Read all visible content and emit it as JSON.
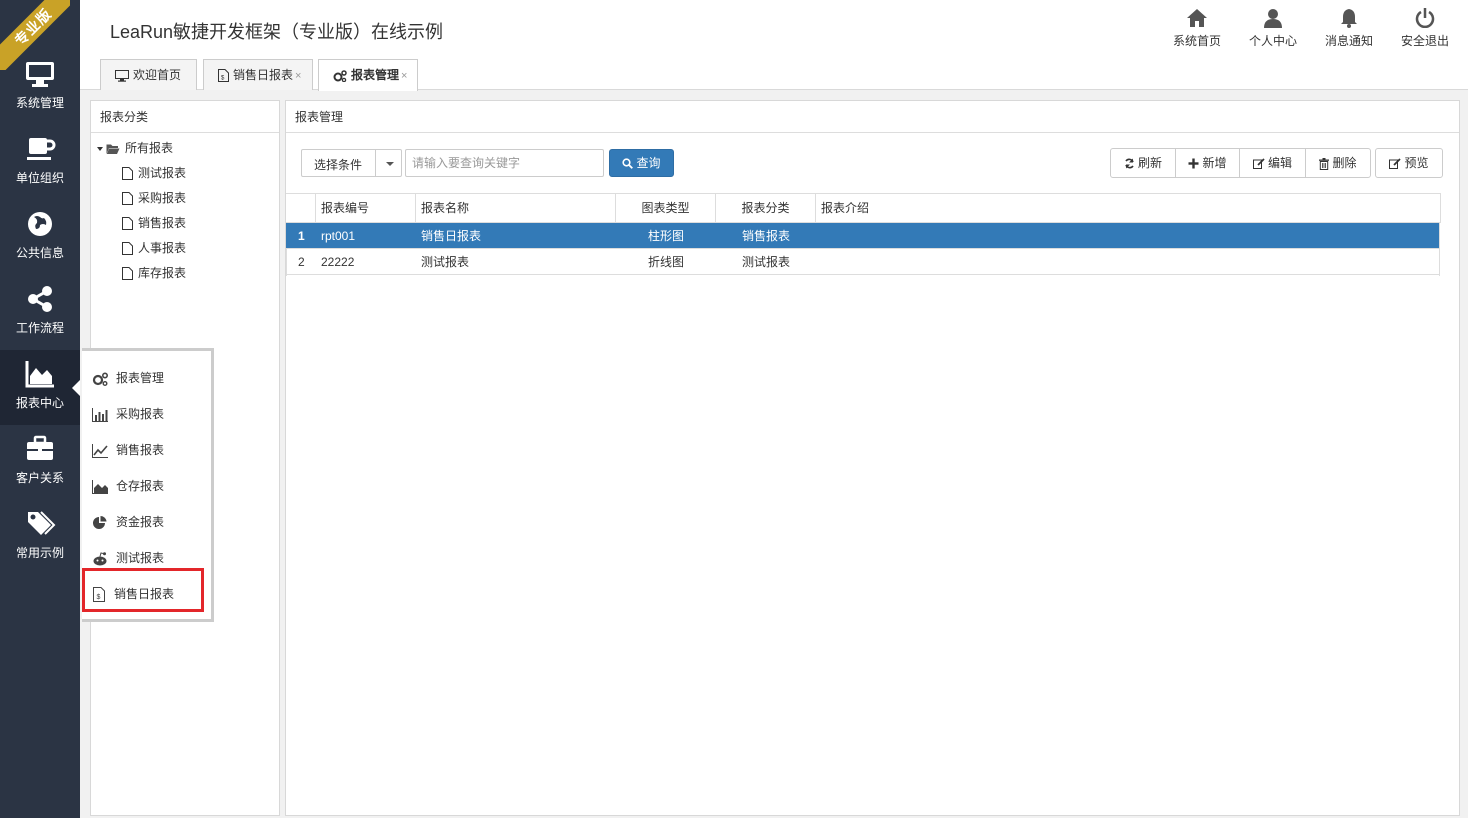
{
  "ribbon": "专业版",
  "app_title": "LeaRun敏捷开发框架（专业版）在线示例",
  "nav": [
    {
      "label": "系统管理",
      "icon": "monitor-icon"
    },
    {
      "label": "单位组织",
      "icon": "coffee-cup-icon"
    },
    {
      "label": "公共信息",
      "icon": "globe-icon"
    },
    {
      "label": "工作流程",
      "icon": "share-icon"
    },
    {
      "label": "报表中心",
      "icon": "area-chart-icon"
    },
    {
      "label": "客户关系",
      "icon": "briefcase-icon"
    },
    {
      "label": "常用示例",
      "icon": "tags-icon"
    }
  ],
  "top_buttons": [
    {
      "label": "系统首页",
      "icon": "home-icon"
    },
    {
      "label": "个人中心",
      "icon": "user-icon"
    },
    {
      "label": "消息通知",
      "icon": "bell-icon"
    },
    {
      "label": "安全退出",
      "icon": "power-icon"
    }
  ],
  "tabs": [
    {
      "label": "欢迎首页",
      "icon": "desktop-icon"
    },
    {
      "label": "销售日报表",
      "icon": "file-icon",
      "close": "×"
    },
    {
      "label": "报表管理",
      "icon": "gears-icon",
      "close": "×"
    }
  ],
  "left_panel": {
    "title": "报表分类",
    "root": "所有报表",
    "children": [
      "测试报表",
      "采购报表",
      "销售报表",
      "人事报表",
      "库存报表"
    ]
  },
  "right_panel": {
    "title": "报表管理",
    "condition_label": "选择条件",
    "search_placeholder": "请输入要查询关键字",
    "query_label": "查询",
    "refresh_label": "刷新",
    "add_label": "新增",
    "edit_label": "编辑",
    "delete_label": "删除",
    "preview_label": "预览"
  },
  "grid": {
    "columns": [
      "报表编号",
      "报表名称",
      "图表类型",
      "报表分类",
      "报表介绍"
    ],
    "rows": [
      {
        "index": "1",
        "code": "rpt001",
        "name": "销售日报表",
        "chart": "柱形图",
        "category": "销售报表",
        "intro": ""
      },
      {
        "index": "2",
        "code": "22222",
        "name": "测试报表",
        "chart": "折线图",
        "category": "测试报表",
        "intro": ""
      }
    ]
  },
  "popup_menu": [
    {
      "label": "报表管理",
      "icon": "gears-icon"
    },
    {
      "label": "采购报表",
      "icon": "bar-chart-icon"
    },
    {
      "label": "销售报表",
      "icon": "line-chart-icon"
    },
    {
      "label": "仓存报表",
      "icon": "area-chart-icon"
    },
    {
      "label": "资金报表",
      "icon": "pie-chart-icon"
    },
    {
      "label": "测试报表",
      "icon": "reddit-icon"
    },
    {
      "label": "销售日报表",
      "icon": "file-icon"
    }
  ],
  "colors": {
    "sidebar": "#2b3444",
    "primary": "#337ab7",
    "highlight_border": "#e3262a",
    "ribbon": "#c9a227"
  }
}
